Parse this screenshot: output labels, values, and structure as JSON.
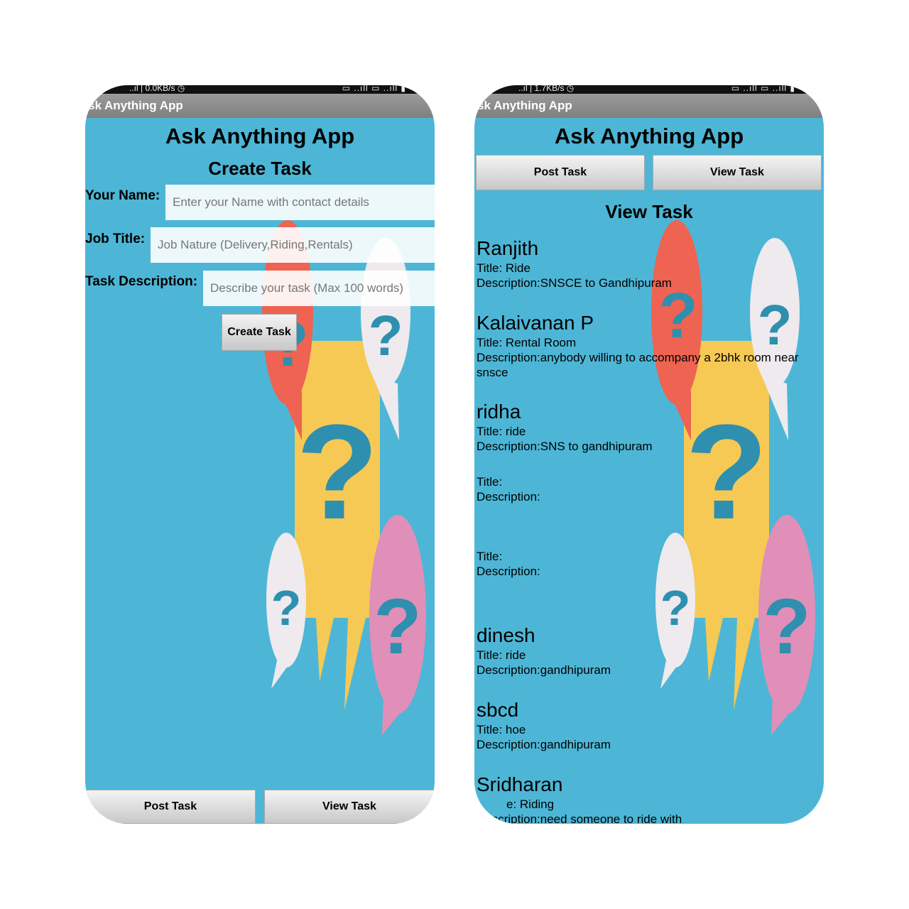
{
  "left_phone": {
    "status_left": "..ıl | 0.0KB/s ◷",
    "status_right": "▭ ..ıll ▭ ..ıll  ▮",
    "appbar_title": "sk Anything App",
    "app_title": "Ask Anything App",
    "section_title": "Create Task",
    "form": {
      "name_label": "Your Name:",
      "name_placeholder": "Enter your Name with contact details",
      "job_label": "Job Title:",
      "job_placeholder": "Job Nature (Delivery,Riding,Rentals)",
      "desc_label": "Task Description:",
      "desc_placeholder": "Describe your task (Max 100 words)",
      "create_button": "Create Task"
    },
    "bottom_nav": {
      "post": "Post Task",
      "view": "View Task"
    }
  },
  "right_phone": {
    "status_left": "..ıl | 1.7KB/s ◷",
    "status_right": "▭ ..ıll ▭ ..ıll  ▮",
    "appbar_title": "sk Anything App",
    "app_title": "Ask Anything App",
    "top_nav": {
      "post": "Post Task",
      "view": "View Task"
    },
    "section_title": "View Task",
    "tasks": [
      {
        "name": "Ranjith",
        "title": "Title: Ride",
        "description": "Description:SNSCE to Gandhipuram"
      },
      {
        "name": "Kalaivanan P",
        "title": "Title:  Rental Room",
        "description": "Description:anybody willing to accompany a 2bhk room near snsce"
      },
      {
        "name": "ridha",
        "title": "Title: ride",
        "description": "Description:SNS to gandhipuram"
      },
      {
        "name": "",
        "title": "Title:",
        "description": "Description:"
      },
      {
        "name": "",
        "title": "Title:",
        "description": "Description:"
      },
      {
        "name": "dinesh",
        "title": "Title: ride",
        "description": "Description:gandhipuram"
      },
      {
        "name": "sbcd",
        "title": "Title: hoe",
        "description": "Description:gandhipuram"
      },
      {
        "name": "Sridharan",
        "title": "e: Riding",
        "description": "Description:need someone to ride with"
      }
    ]
  },
  "colors": {
    "background": "#4db6d6",
    "appbar": "#8c8c8c",
    "bubble_yellow": "#f6c954",
    "bubble_red": "#ee6351",
    "bubble_white": "#eeeaee",
    "bubble_pink": "#e08fb8",
    "question_mark": "#2f8fae"
  }
}
